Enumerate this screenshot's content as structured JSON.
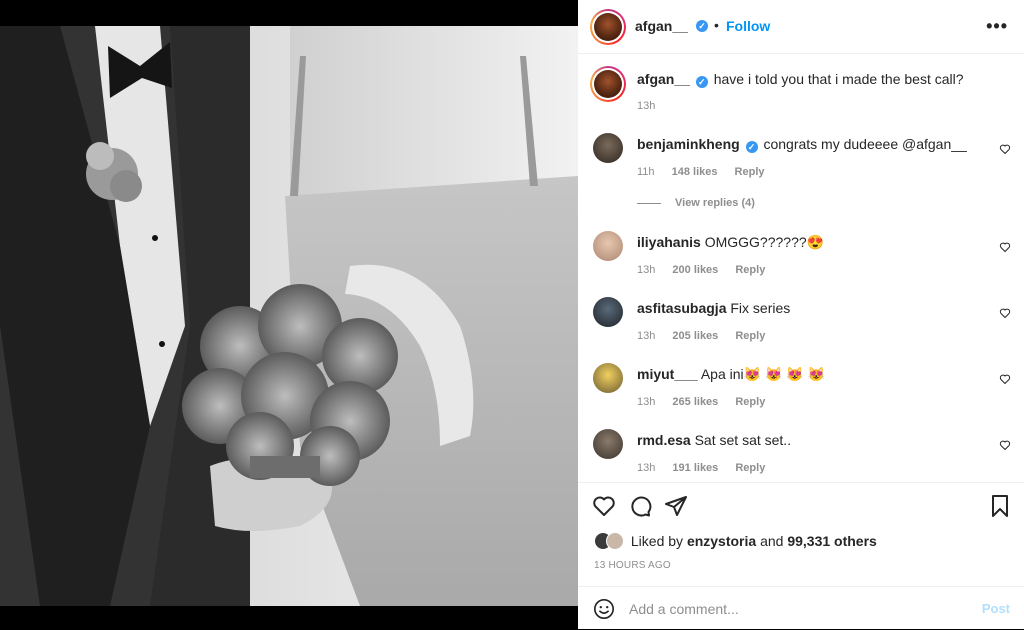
{
  "post": {
    "author": "afgan__",
    "follow_label": "Follow",
    "dot": "•",
    "more": "•••",
    "caption": "have i told you that i made the best call?",
    "caption_time": "13h"
  },
  "comments": [
    {
      "user": "benjaminkheng",
      "verified": true,
      "text": "congrats my dudeeee @afgan__",
      "time": "11h",
      "likes": "148 likes",
      "reply": "Reply"
    },
    {
      "user": "iliyahanis",
      "verified": false,
      "text": "OMGGG??????😍",
      "time": "13h",
      "likes": "200 likes",
      "reply": "Reply"
    },
    {
      "user": "asfitasubagja",
      "verified": false,
      "text": "Fix series",
      "time": "13h",
      "likes": "205 likes",
      "reply": "Reply"
    },
    {
      "user": "miyut___",
      "verified": false,
      "text": "Apa ini😻 😻 😻 😻",
      "time": "13h",
      "likes": "265 likes",
      "reply": "Reply"
    },
    {
      "user": "rmd.esa",
      "verified": false,
      "text": "Sat set sat set..",
      "time": "13h",
      "likes": "191 likes",
      "reply": "Reply"
    }
  ],
  "view_replies": "View replies (4)",
  "likes": {
    "prefix": "Liked by",
    "user": "enzystoria",
    "and": "and",
    "others": "99,331 others"
  },
  "timestamp": "13 HOURS AGO",
  "add_comment": {
    "placeholder": "Add a comment...",
    "post_label": "Post"
  },
  "icons": {
    "like": "heart-icon",
    "comment": "comment-icon",
    "share": "share-icon",
    "save": "bookmark-icon",
    "emoji": "emoji-icon",
    "verified": "verified-badge-icon"
  },
  "colors": {
    "accent": "#0095f6",
    "verified": "#3897f0",
    "muted": "#8e8e8e",
    "post_disabled": "#b2dffc"
  }
}
